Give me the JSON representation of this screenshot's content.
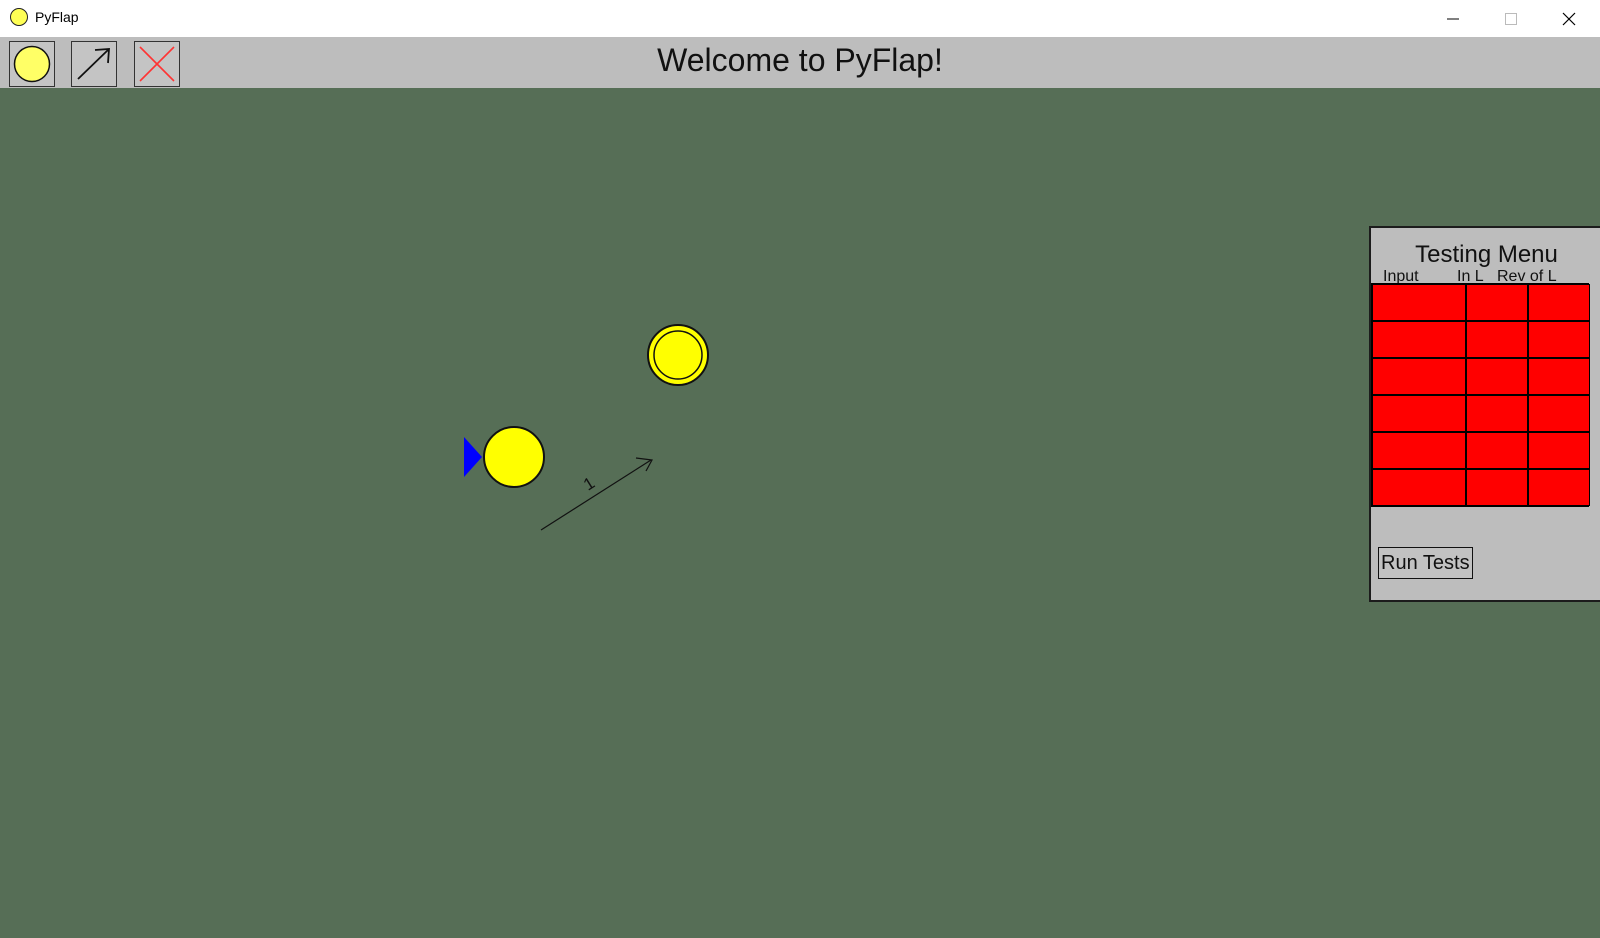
{
  "window": {
    "title": "PyFlap"
  },
  "toolbar": {
    "welcome": "Welcome to PyFlap!",
    "tools": [
      {
        "name": "state",
        "icon": "circle-icon"
      },
      {
        "name": "transition",
        "icon": "arrow-icon"
      },
      {
        "name": "delete",
        "icon": "x-icon"
      }
    ]
  },
  "automaton": {
    "states": [
      {
        "id": "q0",
        "initial": true,
        "accepting": false
      },
      {
        "id": "q1",
        "initial": false,
        "accepting": true
      }
    ],
    "transitions": [
      {
        "from": "q0",
        "to": "q1",
        "label": "1"
      }
    ]
  },
  "testing_menu": {
    "title": "Testing Menu",
    "columns": [
      "Input",
      "In L",
      "Rev of L"
    ],
    "rows": 6,
    "run_label": "Run Tests"
  },
  "colors": {
    "canvas": "#566e56",
    "toolbar": "#bdbdbd",
    "state_fill": "#ffff00",
    "initial_marker": "#0000ff",
    "test_cell": "#ff0000"
  }
}
